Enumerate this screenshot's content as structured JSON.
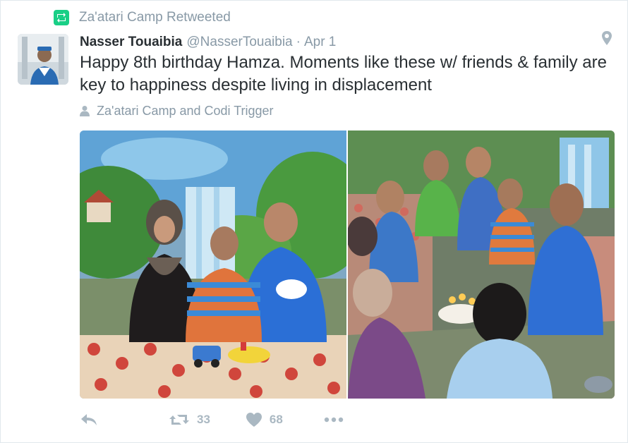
{
  "retweet_context": {
    "label": "Za'atari Camp Retweeted",
    "icon": "retweet-icon",
    "icon_color": "#19cf86"
  },
  "tweet": {
    "author_name": "Nasser Touaibia",
    "author_handle": "@NasserTouaibia",
    "separator": "·",
    "date": "Apr 1",
    "text": "Happy 8th birthday Hamza. Moments like these w/ friends & family are key to happiness despite living in displacement",
    "tagged_users": "Za'atari Camp and Codi Trigger",
    "media_count": 2
  },
  "actions": {
    "reply_icon": "reply-icon",
    "retweet_icon": "retweet-icon",
    "retweet_count": "33",
    "like_icon": "heart-icon",
    "like_count": "68",
    "more_icon": "more-icon"
  },
  "colors": {
    "text_primary": "#292f33",
    "text_muted": "#8899a6",
    "action_gray": "#aab8c2",
    "retweet_green": "#19cf86",
    "border": "#e1e8ed"
  }
}
